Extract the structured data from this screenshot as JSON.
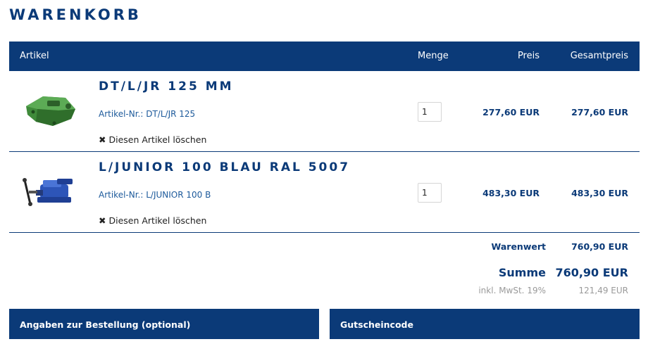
{
  "page": {
    "title": "WARENKORB"
  },
  "table": {
    "headers": {
      "article": "Artikel",
      "quantity": "Menge",
      "price": "Preis",
      "total": "Gesamtpreis"
    }
  },
  "items": [
    {
      "name": "DT/L/JR 125 MM",
      "sku": "Artikel-Nr.: DT/L/JR 125",
      "delete_label": "Diesen Artikel löschen",
      "quantity": "1",
      "price": "277,60 EUR",
      "total": "277,60 EUR",
      "image_icon": "green-vise-jaw-product-image"
    },
    {
      "name": "L/JUNIOR 100 BLAU RAL 5007",
      "sku": "Artikel-Nr.: L/JUNIOR 100 B",
      "delete_label": "Diesen Artikel löschen",
      "quantity": "1",
      "price": "483,30 EUR",
      "total": "483,30 EUR",
      "image_icon": "blue-bench-vise-product-image"
    }
  ],
  "summary": {
    "warenwert_label": "Warenwert",
    "warenwert_value": "760,90 EUR",
    "summe_label": "Summe",
    "summe_value": "760,90 EUR",
    "mwst_label": "inkl. MwSt. 19%",
    "mwst_value": "121,49 EUR"
  },
  "panels": {
    "order_info": "Angaben zur Bestellung (optional)",
    "coupon": "Gutscheincode"
  },
  "colors": {
    "brand": "#0b3a78",
    "link": "#1d5a9b",
    "muted": "#9a9a9a"
  }
}
